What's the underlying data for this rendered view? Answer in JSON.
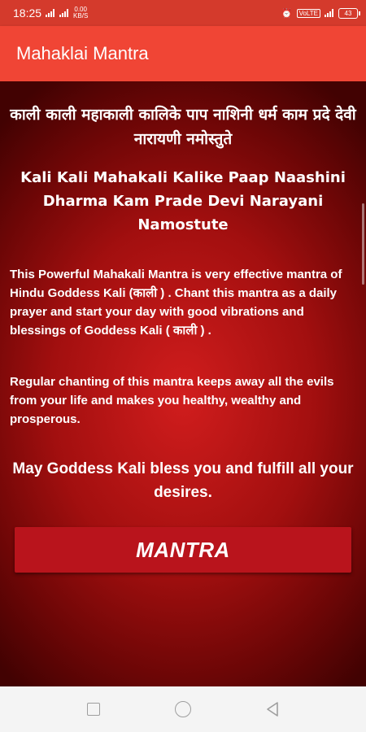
{
  "status_bar": {
    "time": "18:25",
    "speed": "0.00",
    "speed_unit": "KB/S",
    "network": "VoLTE",
    "battery_level": "43"
  },
  "app_bar": {
    "title": "Mahaklai Mantra"
  },
  "content": {
    "mantra_hindi": "काली काली महाकाली कालिके पाप नाशिनी धर्म काम प्रदे देवी नारायणी नमोस्तुते",
    "mantra_english": "Kali Kali Mahakali Kalike Paap Naashini Dharma Kam Prade Devi Narayani Namostute",
    "description_1": "This Powerful Mahakali Mantra is very effective mantra of Hindu Goddess Kali (काली ) . Chant this mantra as a daily prayer and start your day with good vibrations and blessings of Goddess Kali ( काली ) .",
    "description_2": "Regular chanting of this mantra keeps away all the evils from your life and makes you healthy, wealthy and prosperous.",
    "blessing": "May Goddess Kali bless you and fulfill all your desires.",
    "button_label": "MANTRA"
  },
  "colors": {
    "status_bar": "#d43a2c",
    "app_bar": "#f04535",
    "background_center": "#d11d1d",
    "background_edge": "#420202",
    "button": "#b9141c",
    "nav_bar": "#f4f4f4"
  },
  "nav_bar": {
    "icons": [
      "recents-square-icon",
      "home-circle-icon",
      "back-triangle-icon"
    ]
  }
}
